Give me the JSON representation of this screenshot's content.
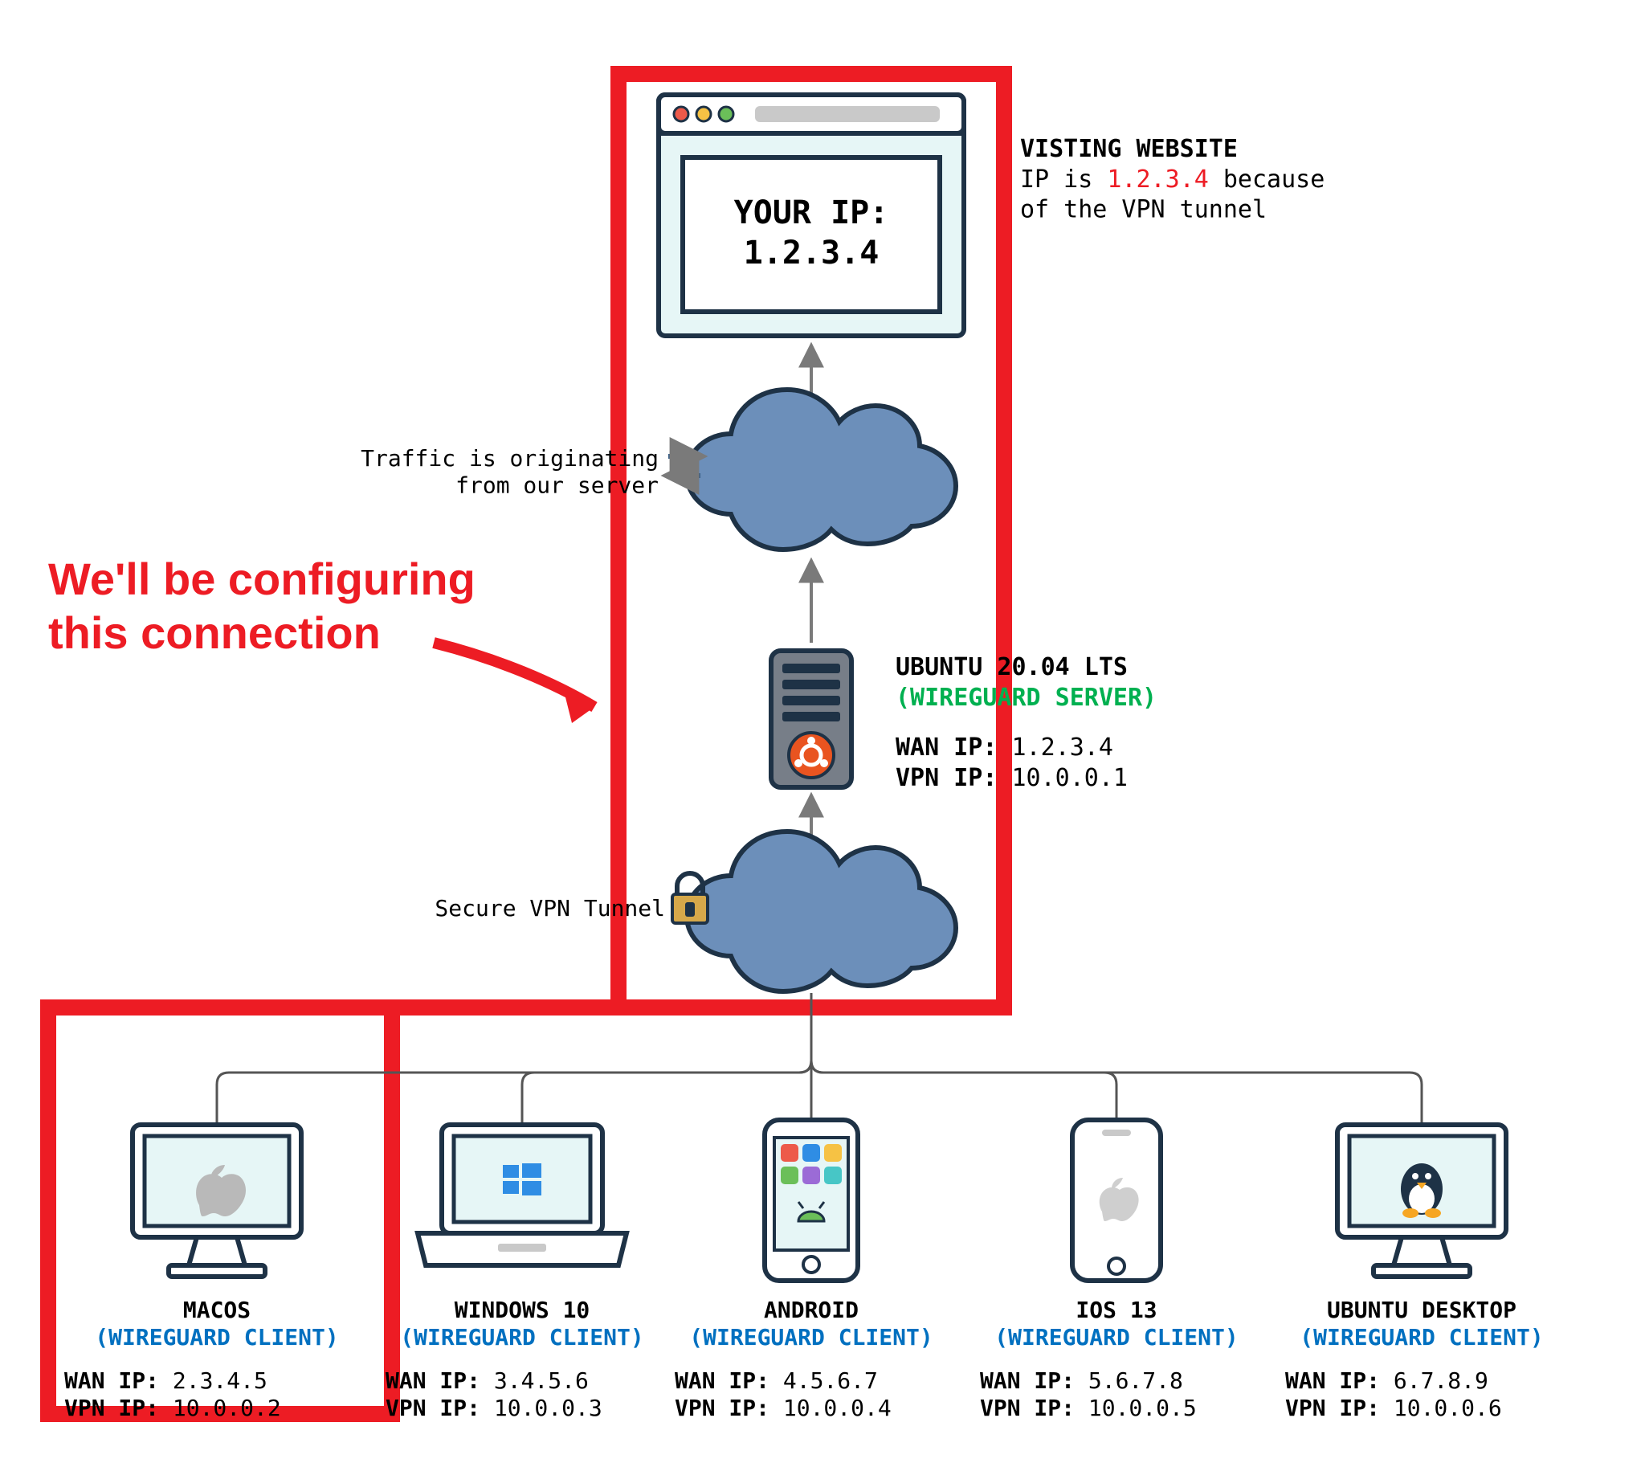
{
  "browser": {
    "line1": "YOUR IP:",
    "line2": "1.2.3.4"
  },
  "website_caption": {
    "title": "VISTING WEBSITE",
    "pre": "IP is ",
    "ip": "1.2.3.4",
    "post": " because\nof the VPN tunnel"
  },
  "traffic_caption": "Traffic is originating\n from our server",
  "server": {
    "title": "UBUNTU 20.04 LTS",
    "role": "(WIREGUARD SERVER)",
    "wan_lbl": "WAN IP: ",
    "wan_val": "1.2.3.4",
    "vpn_lbl": "VPN IP: ",
    "vpn_val": "10.0.0.1"
  },
  "tunnel_caption": "Secure VPN Tunnel",
  "highlight": "We'll be configuring\nthis connection",
  "clients": [
    {
      "name": "MACOS",
      "role": "(WIREGUARD CLIENT)",
      "wan_lbl": "WAN IP: ",
      "wan_val": "2.3.4.5",
      "vpn_lbl": "VPN IP: ",
      "vpn_val": "10.0.0.2"
    },
    {
      "name": "WINDOWS 10",
      "role": "(WIREGUARD CLIENT)",
      "wan_lbl": "WAN IP: ",
      "wan_val": "3.4.5.6",
      "vpn_lbl": "VPN IP: ",
      "vpn_val": "10.0.0.3"
    },
    {
      "name": "ANDROID",
      "role": "(WIREGUARD CLIENT)",
      "wan_lbl": "WAN IP: ",
      "wan_val": "4.5.6.7",
      "vpn_lbl": "VPN IP: ",
      "vpn_val": "10.0.0.4"
    },
    {
      "name": "IOS 13",
      "role": "(WIREGUARD CLIENT)",
      "wan_lbl": "WAN IP: ",
      "wan_val": "5.6.7.8",
      "vpn_lbl": "VPN IP: ",
      "vpn_val": "10.0.0.5"
    },
    {
      "name": "UBUNTU DESKTOP",
      "role": "(WIREGUARD CLIENT)",
      "wan_lbl": "WAN IP: ",
      "wan_val": "6.7.8.9",
      "vpn_lbl": "VPN IP: ",
      "vpn_val": "10.0.0.6"
    }
  ],
  "colors": {
    "red": "#ed1c24",
    "green": "#00b050",
    "blue": "#0070c0",
    "cloud_fill": "#6c8fba",
    "cloud_stroke": "#1e3246",
    "arrow": "#7a7a7a",
    "connector": "#555"
  }
}
